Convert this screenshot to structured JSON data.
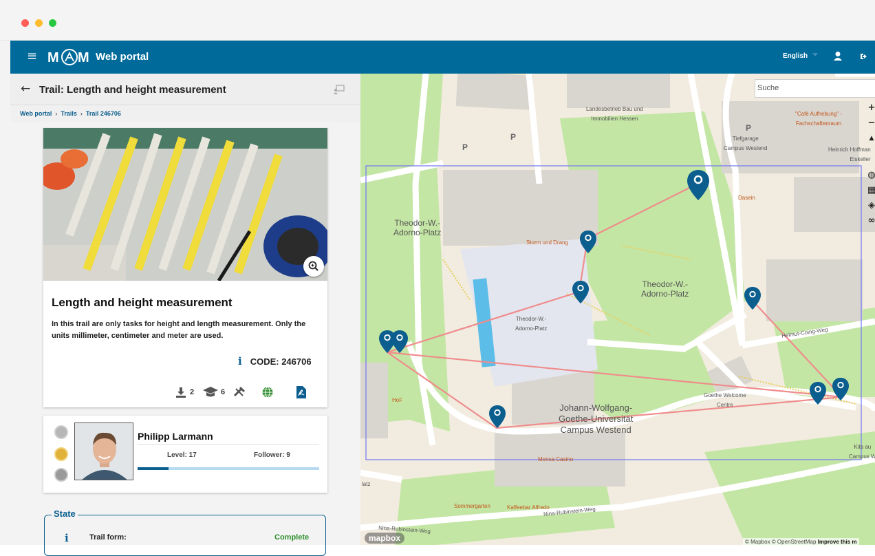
{
  "nav": {
    "title": "Web portal",
    "language": "English",
    "menu_glyph": "≡",
    "brand_color": "#006a9a"
  },
  "trail": {
    "header_title": "Trail: Length and height measurement",
    "breadcrumb": [
      "Web portal",
      "Trails",
      "Trail 246706"
    ],
    "name": "Length and height measurement",
    "description": "In this trail are only tasks for height and length measurement. Only the units millimeter, centimeter and meter are used.",
    "code": "CODE: 246706",
    "downloads": "2",
    "students": "6"
  },
  "author": {
    "name": "Philipp Larmann",
    "level": "Level: 17",
    "follower": "Follower: 9",
    "progress": 0.17
  },
  "state": {
    "legend": "State",
    "rows": [
      {
        "label": "Trail form:",
        "value": "Complete"
      }
    ]
  },
  "map": {
    "search_placeholder": "Suche",
    "logo": "mapbox",
    "attribution": "© Mapbox © OpenStreetMap",
    "attribution_link": "Improve this m",
    "labels": {
      "adorno_left": "Theodor-W.-\nAdorno-Platz",
      "adorno_right": "Theodor-W.-\nAdorno-Platz",
      "adorno_center": "Theodor-W.-\nAdorno-Platz",
      "campus": "Johann-Wolfgang-\nGoethe-Universität\nCampus Westend",
      "landesbetrieb": "Landesbetrieb Bau und\nImmobilien Hessen",
      "tiefgarage": "Tiefgarage\nCampus Westend",
      "sturm": "Sturm und Drang",
      "dasein": "Dasein",
      "cafe": "\"Café Aufhebung\" -\nFachschaftenraum",
      "heinrich": "Heinrich Hoffman\nEiskeller",
      "helmut": "Helmut-Coing-Weg",
      "welcome": "Goethe Welcome\nCentre",
      "mensa": "Mensa Casino",
      "sommergarten": "Sommergarten",
      "kaffeebar": "Kaffeebar Alfredo",
      "nina1": "Nina-Rubinstein-Weg",
      "nina2": "Nina-Rubinstein-Weg",
      "hof": "HoF",
      "kita": "Kita au\nCampus W",
      "platz": "latz",
      "p1": "P",
      "p2": "P",
      "p3": "P"
    }
  }
}
